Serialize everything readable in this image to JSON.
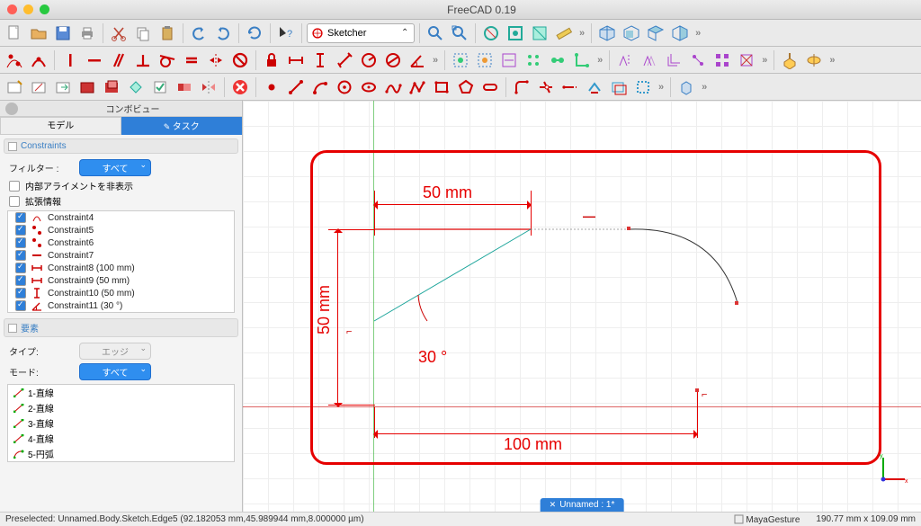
{
  "app_title": "FreeCAD 0.19",
  "workbench": "Sketcher",
  "sidebar": {
    "combo_title": "コンボビュー",
    "tabs": {
      "model": "モデル",
      "task": "タスク"
    },
    "constraints_header": "Constraints",
    "filter_label": "フィルター :",
    "filter_value": "すべて",
    "hide_alignment": "内部アライメントを非表示",
    "extended_info": "拡張情報",
    "list": [
      {
        "label": "Constraint4",
        "icon": "coincident"
      },
      {
        "label": "Constraint5",
        "icon": "pt-on"
      },
      {
        "label": "Constraint6",
        "icon": "pt-on"
      },
      {
        "label": "Constraint7",
        "icon": "horiz"
      },
      {
        "label": "Constraint8 (100 mm)",
        "icon": "dist-h"
      },
      {
        "label": "Constraint9 (50 mm)",
        "icon": "dist-h"
      },
      {
        "label": "Constraint10 (50 mm)",
        "icon": "dist-v"
      },
      {
        "label": "Constraint11 (30 °)",
        "icon": "angle"
      }
    ],
    "elements_header": "要素",
    "type_label": "タイプ:",
    "type_value": "エッジ",
    "mode_label": "モード:",
    "mode_value": "すべて",
    "elements": [
      "1-直線",
      "2-直線",
      "3-直線",
      "4-直線",
      "5-円弧"
    ]
  },
  "canvas": {
    "dim_50h": "50 mm",
    "dim_50v": "50 mm",
    "dim_100": "100 mm",
    "angle": "30 °",
    "doc_tab": "Unnamed : 1*"
  },
  "status": {
    "preselect": "Preselected: Unnamed.Body.Sketch.Edge5 (92.182053 mm,45.989944 mm,8.000000 µm)",
    "nav": "MayaGesture",
    "dims": "190.77 mm x 109.09 mm"
  }
}
